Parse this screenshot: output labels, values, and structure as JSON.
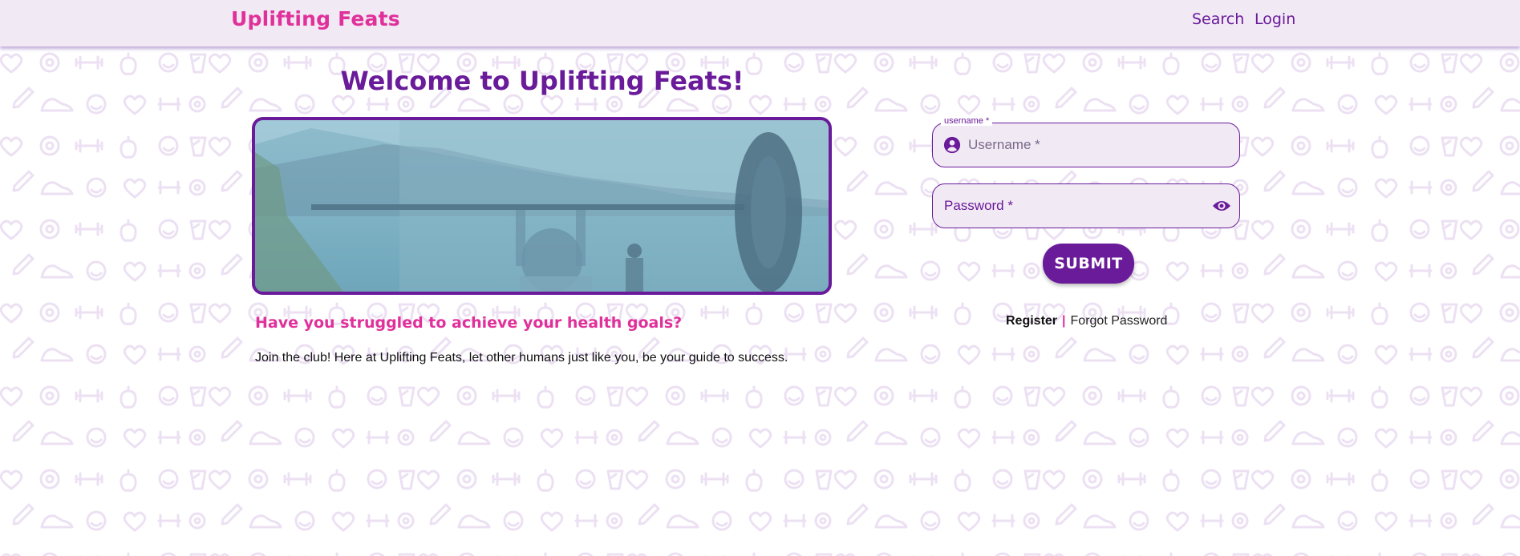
{
  "header": {
    "brand": "Uplifting Feats",
    "nav": [
      {
        "label": "Search"
      },
      {
        "label": "Login"
      }
    ]
  },
  "hero": {
    "title": "Welcome to Uplifting Feats!",
    "tagline": "Have you struggled to achieve your health goals?",
    "blurb": "Join the club! Here at Uplifting Feats, let other humans just like you, be your guide to success."
  },
  "login_form": {
    "username_legend": "username *",
    "username_placeholder": "Username *",
    "username_value": "",
    "password_placeholder": "Password *",
    "password_value": "",
    "submit_label": "SUBMIT",
    "register_label": "Register",
    "separator": "|",
    "forgot_label": "Forgot Password"
  },
  "icons": {
    "user": "account-circle-icon",
    "password_toggle": "eye-icon"
  },
  "colors": {
    "brand_pink": "#e0309a",
    "primary_purple": "#6a1b9a",
    "nav_background": "#f1e9f4",
    "field_background": "#f1e9f4",
    "pattern_icon": "#ede0f2"
  }
}
